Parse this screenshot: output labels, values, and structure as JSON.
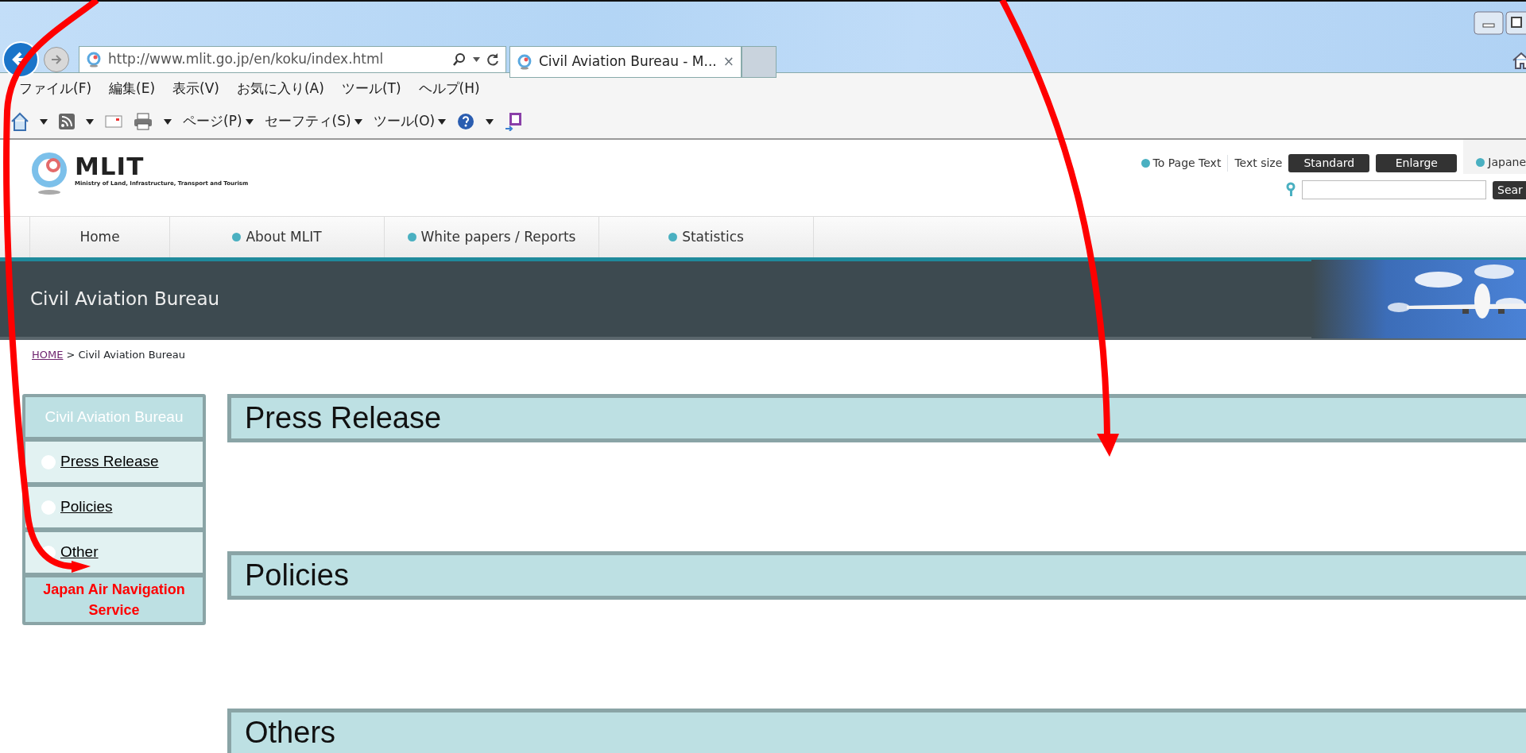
{
  "browser": {
    "address": "http://www.mlit.go.jp/en/koku/index.html",
    "tab_title": "Civil Aviation Bureau - M...",
    "tab_close": "×",
    "menu": [
      "ファイル(F)",
      "編集(E)",
      "表示(V)",
      "お気に入り(A)",
      "ツール(T)",
      "ヘルプ(H)"
    ],
    "command_bar": [
      "ページ(P)",
      "セーフティ(S)",
      "ツール(O)"
    ]
  },
  "site": {
    "logo": "MLIT",
    "logo_subtitle": "Ministry of Land, Infrastructure, Transport and Tourism",
    "to_page_text": "To Page Text",
    "text_size_label": "Text size",
    "size_buttons": [
      "Standard",
      "Enlarge"
    ],
    "language": "Japane",
    "search_button": "Sear",
    "nav": [
      {
        "label": "Home",
        "kind": "plain"
      },
      {
        "label": "About MLIT",
        "kind": "bullet"
      },
      {
        "label": "White papers / Reports",
        "kind": "bullet"
      },
      {
        "label": "Statistics",
        "kind": "bullet"
      }
    ],
    "banner_title": "Civil Aviation Bureau",
    "breadcrumb": {
      "home": "HOME",
      "current": "> Civil Aviation Bureau"
    }
  },
  "sidebar": {
    "title": "Civil Aviation Bureau",
    "items": [
      {
        "label": "Press Release",
        "kind": "link"
      },
      {
        "label": "Policies",
        "kind": "link"
      },
      {
        "label": "Other",
        "kind": "link"
      },
      {
        "label": "Japan Air Navigation Service",
        "kind": "highlight"
      }
    ]
  },
  "sections": [
    "Press Release",
    "Policies",
    "Others"
  ]
}
